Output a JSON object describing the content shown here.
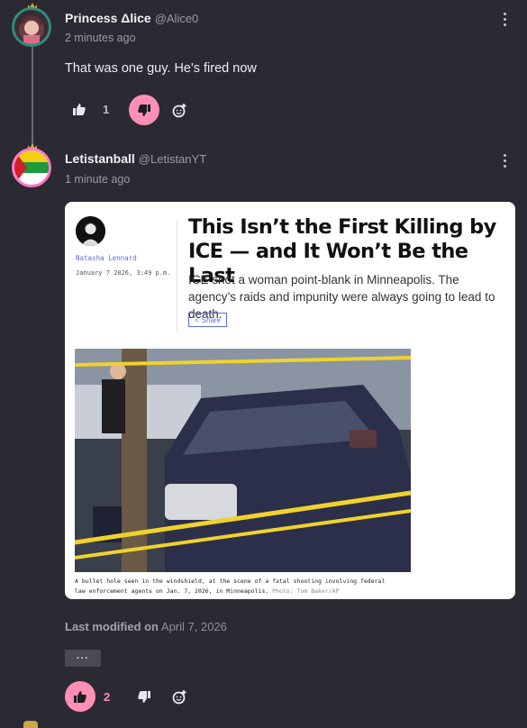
{
  "comments": [
    {
      "author": "Princess Δlice",
      "handle": "@Alice0",
      "time": "2 minutes ago",
      "text": "That was one guy. He's fired now",
      "likes": "1"
    },
    {
      "author": "Letistanball",
      "handle": "@LetistanYT",
      "time": "1 minute ago",
      "likes": "2",
      "embed": {
        "headline": "This Isn’t the First Killing by ICE — and It Won’t Be the Last",
        "subheadline": "ICE shot a woman point-blank in Minneapolis. The agency’s raids and impunity were always going to lead to death.",
        "author": "Natasha Lennard",
        "date": "January 7 2026, 3:49 p.m.",
        "share_label": "Share",
        "caption": "A bullet hole seen in the windshield, at the scene of a fatal shooting involving federal law enforcement agents on Jan. 7, 2026, in Minneapolis.",
        "photo_credit": "Photo: Tom Baker/AP"
      },
      "modified_label": "Last modified on",
      "modified_date": "April 7, 2026",
      "more_label": "···"
    }
  ],
  "colors": {
    "background": "#2b2a33",
    "accent_pink": "#ff8fb4",
    "link_blue": "#5b6ee1"
  },
  "icons": {
    "like": "thumbs-up-icon",
    "dislike": "thumbs-down-icon",
    "react": "add-reaction-icon",
    "menu": "kebab-menu-icon"
  }
}
